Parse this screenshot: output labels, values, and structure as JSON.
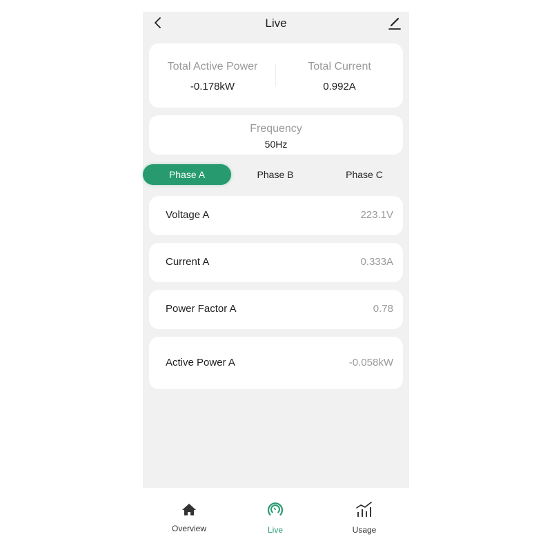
{
  "header": {
    "title": "Live",
    "back_icon": "chevron-left-icon",
    "edit_icon": "pencil-icon"
  },
  "summary": {
    "total_active_power": {
      "label": "Total Active Power",
      "value": "-0.178kW"
    },
    "total_current": {
      "label": "Total Current",
      "value": "0.992A"
    }
  },
  "frequency": {
    "label": "Frequency",
    "value": "50Hz"
  },
  "phase_tabs": [
    {
      "label": "Phase A",
      "selected": true
    },
    {
      "label": "Phase B",
      "selected": false
    },
    {
      "label": "Phase C",
      "selected": false
    }
  ],
  "metrics": [
    {
      "label": "Voltage A",
      "value": "223.1V"
    },
    {
      "label": "Current A",
      "value": "0.333A"
    },
    {
      "label": "Power Factor A",
      "value": "0.78"
    },
    {
      "label": "Active Power A",
      "value": "-0.058kW"
    }
  ],
  "bottom_tabs": [
    {
      "label": "Overview",
      "icon": "home-icon",
      "active": false
    },
    {
      "label": "Live",
      "icon": "gauge-icon",
      "active": true
    },
    {
      "label": "Usage",
      "icon": "bar-line-chart-icon",
      "active": false
    }
  ],
  "colors": {
    "accent": "#279b6f",
    "background": "#f1f1f1",
    "card": "#ffffff",
    "muted_text": "#9a9a9a",
    "primary_text": "#1f1f1f"
  }
}
